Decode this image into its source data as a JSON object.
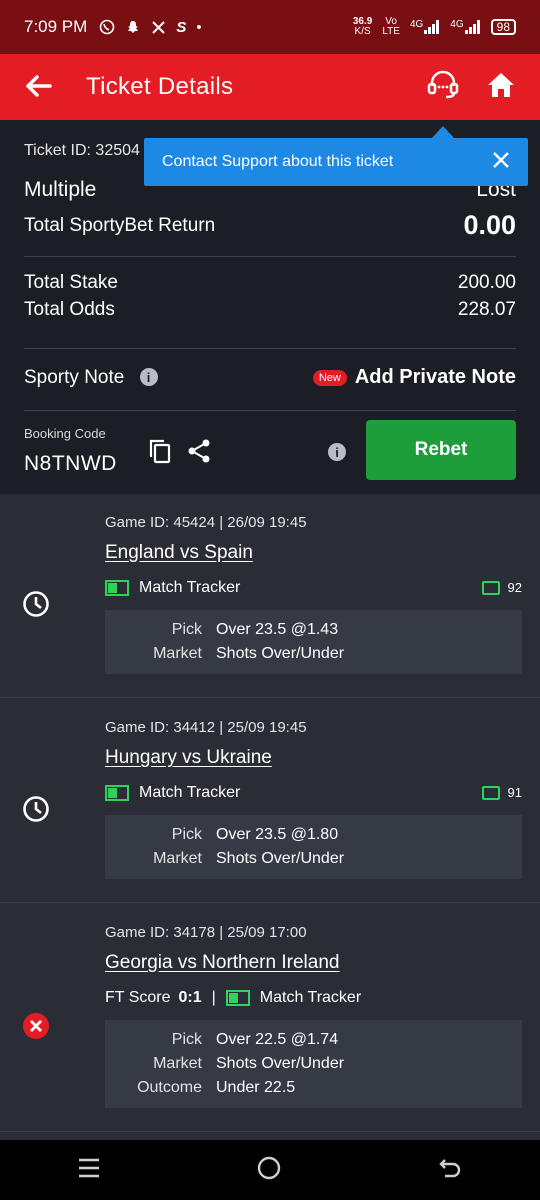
{
  "status_bar": {
    "time": "7:09 PM",
    "speed": "36.9",
    "speed_unit": "K/S",
    "vo": "Vo",
    "lte": "LTE",
    "net1": "4G",
    "net2": "4G",
    "battery": "98",
    "dot": "•",
    "s_glyph": "S"
  },
  "header": {
    "title": "Ticket Details"
  },
  "tooltip": {
    "text": "Contact Support about this ticket"
  },
  "summary": {
    "ticket_id": "Ticket ID: 32504",
    "bet_type": "Multiple",
    "status": "Lost",
    "return_label": "Total SportyBet Return",
    "return_value": "0.00",
    "stake_label": "Total Stake",
    "stake_value": "200.00",
    "odds_label": "Total Odds",
    "odds_value": "228.07",
    "note_label": "Sporty Note",
    "new_badge": "New",
    "add_note": "Add Private Note",
    "booking_label": "Booking Code",
    "booking_code": "N8TNWD",
    "rebet": "Rebet"
  },
  "games": [
    {
      "game_id": "Game ID: 45424 | 26/09 19:45",
      "teams": "England vs Spain",
      "tracker": "Match Tracker",
      "comments": "92",
      "pick_label": "Pick",
      "pick": "Over 23.5 @1.43",
      "market_label": "Market",
      "market": "Shots Over/Under",
      "status": "pending"
    },
    {
      "game_id": "Game ID: 34412 | 25/09 19:45",
      "teams": "Hungary vs Ukraine",
      "tracker": "Match Tracker",
      "comments": "91",
      "pick_label": "Pick",
      "pick": "Over 23.5 @1.80",
      "market_label": "Market",
      "market": "Shots Over/Under",
      "status": "pending"
    },
    {
      "game_id": "Game ID: 34178 | 25/09 17:00",
      "teams": "Georgia vs Northern Ireland",
      "ft_label": "FT Score",
      "ft_score": "0:1",
      "separator": "|",
      "tracker": "Match Tracker",
      "pick_label": "Pick",
      "pick": "Over 22.5 @1.74",
      "market_label": "Market",
      "market": "Shots Over/Under",
      "outcome_label": "Outcome",
      "outcome": "Under 22.5",
      "status": "lost"
    }
  ],
  "colors": {
    "brand_red": "#e41c23",
    "status_bar": "#7a0f13",
    "rebet_green": "#1e9e3b",
    "tracker_green": "#2fd35b",
    "tooltip_blue": "#1e88e5"
  }
}
